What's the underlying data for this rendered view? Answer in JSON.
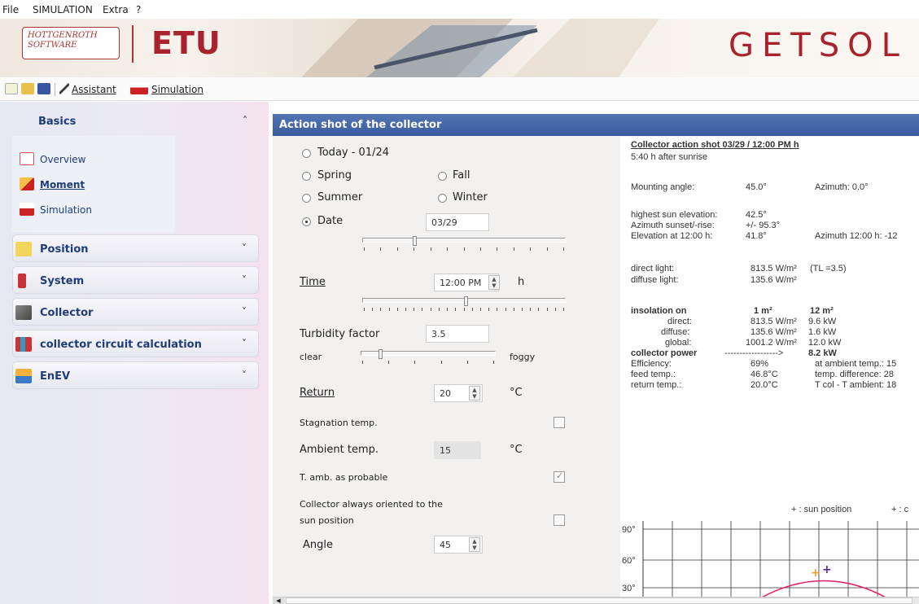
{
  "menu": {
    "file": "File",
    "simulation": "SIMULATION",
    "extra": "Extra",
    "help": "?"
  },
  "banner": {
    "logo_line1": "HOTTGENROTH",
    "logo_line2": "SOFTWARE",
    "product": "ETU",
    "app_name": "GETSOL"
  },
  "toolbar": {
    "assistant": "Assistant",
    "simulation": "Simulation"
  },
  "sidebar": {
    "basics": {
      "title": "Basics",
      "items": [
        "Overview",
        "Moment",
        "Simulation"
      ]
    },
    "sections": [
      "Position",
      "System",
      "Collector",
      "collector circuit calculation",
      "EnEV"
    ],
    "chevron_up": "˄",
    "chevron_down": "˅"
  },
  "panel": {
    "title": "Action shot of the collector",
    "radios": {
      "today": "Today - 01/24",
      "spring": "Spring",
      "fall": "Fall",
      "summer": "Summer",
      "winter": "Winter",
      "date": "Date"
    },
    "selected_radio": "Date",
    "date_value": "03/29",
    "time_label": "Time",
    "time_value": "12:00 PM",
    "time_unit": "h",
    "turbidity_label": "Turbidity factor",
    "turbidity_value": "3.5",
    "clear_label": "clear",
    "foggy_label": "foggy",
    "return_label": "Return",
    "return_value": "20",
    "return_unit": "°C",
    "stagnation_label": "Stagnation temp.",
    "ambient_label": "Ambient temp.",
    "ambient_value": "15",
    "ambient_unit": "°C",
    "tamb_label": "T. amb. as probable",
    "oriented_label_1": "Collector always oriented to the",
    "oriented_label_2": "sun position",
    "angle_label": "Angle",
    "angle_value": "45",
    "stagnation_checked": false,
    "tamb_checked": true,
    "oriented_checked": false
  },
  "info": {
    "heading": "Collector action shot 03/29 / 12:00 PM h",
    "after_sunrise": "5:40 h after sunrise",
    "mounting_label": "Mounting angle:",
    "mounting_value": "45.0°",
    "azimuth_label": "Azimuth: 0.0°",
    "highest_label": "highest sun elevation:",
    "highest_value": "42.5°",
    "azss_label": "Azimuth sunset/-rise:",
    "azss_value": "+/- 95.3°",
    "elev_label": "Elevation at 12:00 h:",
    "elev_value": "41.8°",
    "az1200_label": "Azimuth 12:00 h: -12",
    "direct_label": "direct light:",
    "direct_value": "813.5 W/m²",
    "tl_value": "(TL =3.5)",
    "diffuse_label": "diffuse light:",
    "diffuse_value": "135.6 W/m²",
    "insolation_label": "insolation on",
    "col_1m": "1 m²",
    "col_12m": "12 m²",
    "ins_direct_label": "direct:",
    "ins_direct_1": "813.5 W/m²",
    "ins_direct_12": "9.6 kW",
    "ins_diffuse_label": "diffuse:",
    "ins_diffuse_1": "135.6 W/m²",
    "ins_diffuse_12": "1.6 kW",
    "ins_global_label": "global:",
    "ins_global_1": "1001.2 W/m²",
    "ins_global_12": "12.0 kW",
    "power_label": "collector power",
    "power_arrow": "------------------>",
    "power_value": "8.2 kW",
    "eff_label": "Efficiency:",
    "eff_value": "69%",
    "eff_right": "at ambient temp.: 15",
    "feed_label": "feed temp.:",
    "feed_value": "46.8°C",
    "feed_right": "temp. difference: 28",
    "ret_label": "return temp.:",
    "ret_value": "20.0°C",
    "ret_right": "T col - T ambient: 18",
    "legend_sun": "+ : sun position",
    "legend_c": "+ : c",
    "colors": {
      "sun_marker": "#f0a030",
      "collector_marker": "#5a2a90",
      "sun_path": "#e0206a"
    }
  },
  "chart_data": {
    "type": "line",
    "y_ticks": [
      "90°",
      "60°",
      "30°"
    ],
    "ylim": [
      30,
      90
    ],
    "grid": true,
    "series": [
      {
        "name": "sun position",
        "color": "#e0206a"
      }
    ]
  }
}
